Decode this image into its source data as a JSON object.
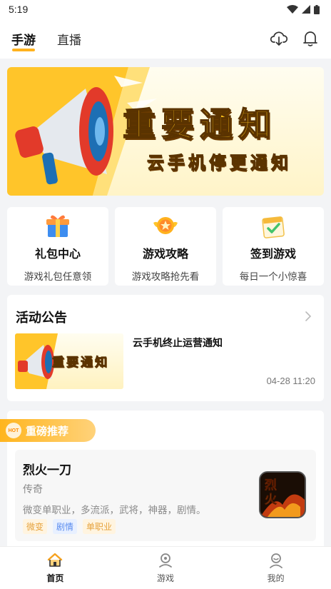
{
  "status_bar": {
    "time": "5:19"
  },
  "top_nav": {
    "tabs": [
      {
        "label": "手游",
        "active": true
      },
      {
        "label": "直播",
        "active": false
      }
    ],
    "actions": [
      "download-icon",
      "bell-icon"
    ]
  },
  "banner": {
    "title": "重要通知",
    "subtitle": "云手机停更通知"
  },
  "quick_links": [
    {
      "icon": "gift-icon",
      "title": "礼包中心",
      "desc": "游戏礼包任意领"
    },
    {
      "icon": "star-badge-icon",
      "title": "游戏攻略",
      "desc": "游戏攻略抢先看"
    },
    {
      "icon": "calendar-check-icon",
      "title": "签到游戏",
      "desc": "每日一个小惊喜"
    }
  ],
  "announcements": {
    "title": "活动公告",
    "items": [
      {
        "thumb_text": "重要通知",
        "title": "云手机终止运营通知",
        "time": "04-28 11:20"
      }
    ]
  },
  "recommend": {
    "badge_icon_text": "HOT",
    "badge_label": "重磅推荐",
    "game": {
      "name": "烈火一刀",
      "genre": "传奇",
      "desc": "微变单职业，多流派，武将，神器，剧情。",
      "icon_text": "烈火",
      "tags": [
        {
          "label": "微变",
          "color": "#e6a23c",
          "bg": "#fff4e0"
        },
        {
          "label": "剧情",
          "color": "#5b8def",
          "bg": "#e8f0ff"
        },
        {
          "label": "单职业",
          "color": "#e6a23c",
          "bg": "#fff4e0"
        }
      ]
    }
  },
  "bottom_nav": [
    {
      "icon": "home-icon",
      "label": "首页",
      "active": true
    },
    {
      "icon": "gamepad-icon",
      "label": "游戏",
      "active": false
    },
    {
      "icon": "profile-icon",
      "label": "我的",
      "active": false
    }
  ],
  "colors": {
    "accent": "#ffb21e",
    "background": "#f3f4f6"
  }
}
